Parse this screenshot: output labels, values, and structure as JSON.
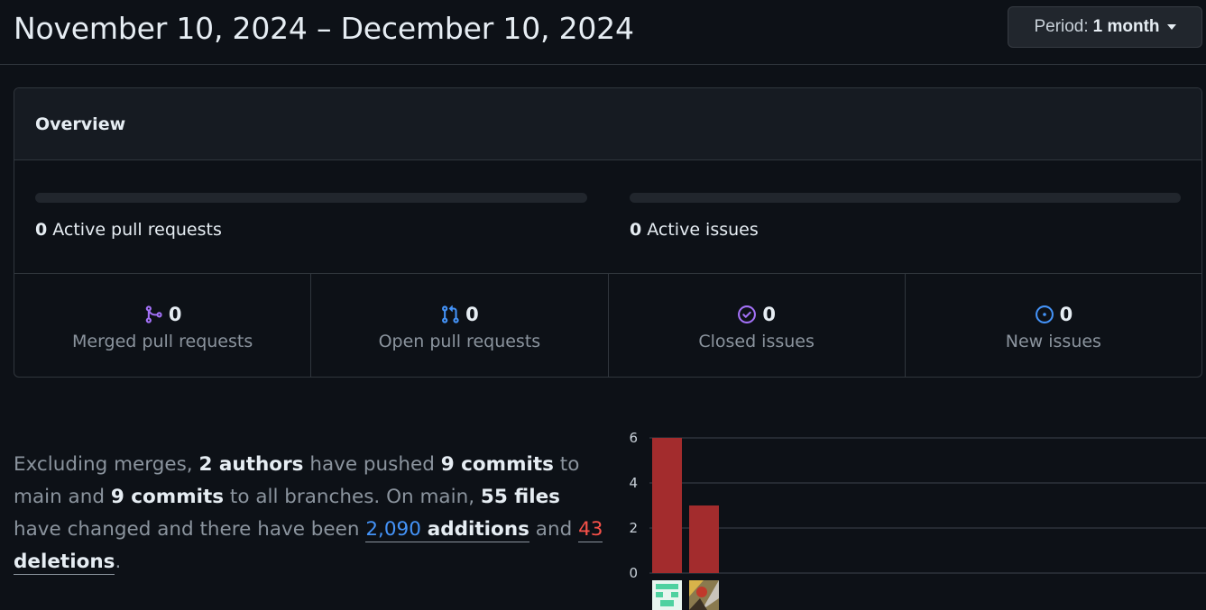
{
  "header": {
    "date_range": "November 10, 2024 – December 10, 2024",
    "period_label": "Period:",
    "period_value": "1 month"
  },
  "overview": {
    "title": "Overview",
    "active_prs": {
      "count": "0",
      "label": "Active pull requests",
      "fill_fraction": 0
    },
    "active_issues": {
      "count": "0",
      "label": "Active issues",
      "fill_fraction": 0
    },
    "stats": [
      {
        "icon": "git-merge-icon",
        "count": "0",
        "label": "Merged pull requests",
        "color": "#a371f7"
      },
      {
        "icon": "git-pull-request-icon",
        "count": "0",
        "label": "Open pull requests",
        "color": "#4493f8"
      },
      {
        "icon": "issue-closed-icon",
        "count": "0",
        "label": "Closed issues",
        "color": "#a371f7"
      },
      {
        "icon": "issue-opened-icon",
        "count": "0",
        "label": "New issues",
        "color": "#4493f8"
      }
    ]
  },
  "summary": {
    "p1": "Excluding merges, ",
    "authors": "2 authors",
    "p2": " have pushed ",
    "commits_main": "9 commits",
    "p3": " to main and ",
    "commits_all": "9 commits",
    "p4": " to all branches. On main, ",
    "files": "55 files",
    "p5": " have changed and there have been ",
    "additions_num": "2,090",
    "additions_word": "additions",
    "p6": " and ",
    "deletions_num": "43",
    "deletions_word": "deletions",
    "p7": "."
  },
  "chart_data": {
    "type": "bar",
    "categories": [
      "author-1",
      "author-2"
    ],
    "values": [
      6,
      3
    ],
    "ylim": [
      0,
      6
    ],
    "yticks": [
      "0",
      "2",
      "4",
      "6"
    ],
    "bar_color": "#a32c2d",
    "grid": true
  }
}
